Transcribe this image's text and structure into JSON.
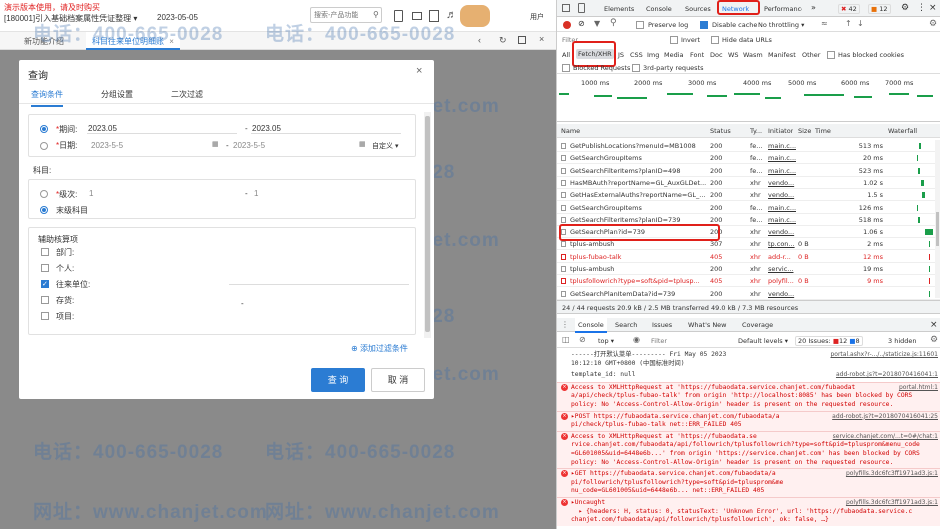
{
  "app": {
    "demo_notice": "演示版本使用，请及时购买",
    "account": "[180001]引入基础档案属性凭证整理",
    "date": "2023-05-05",
    "search_placeholder": "搜索-产品功能",
    "user": "用户",
    "tabs": [
      "新功能介绍",
      "科目往来单位明细账"
    ],
    "watermark_phone": "电话：400-665-0028",
    "watermark_url": "网址：www.chanjet.com"
  },
  "dialog": {
    "title": "查询",
    "tabs": [
      "查询条件",
      "分组设置",
      "二次过滤"
    ],
    "period_label": "期间:",
    "period_from": "2023.05",
    "period_to": "2023.05",
    "date_label": "日期:",
    "date_from": "2023-5-5",
    "date_to": "2023-5-5",
    "date_custom": "自定义",
    "subject_label": "科目:",
    "level_label": "级次:",
    "level_from": "1",
    "level_to": "1",
    "last_level": "末级科目",
    "aux_title": "辅助核算项",
    "aux_items": [
      {
        "label": "部门:",
        "checked": false
      },
      {
        "label": "个人:",
        "checked": false
      },
      {
        "label": "往来单位:",
        "checked": true
      },
      {
        "label": "存货:",
        "checked": false
      },
      {
        "label": "项目:",
        "checked": false
      }
    ],
    "add_filter": "添加过滤条件",
    "query_button": "查 询",
    "cancel_button": "取 消"
  },
  "devtools": {
    "tabs": [
      "Elements",
      "Console",
      "Sources",
      "Network",
      "Performance"
    ],
    "issues_errors": "42",
    "issues_warn": "12",
    "toolbar": {
      "preserve_log": "Preserve log",
      "disable_cache": "Disable cache",
      "throttling": "No throttling"
    },
    "filter_placeholder": "Filter",
    "invert": "Invert",
    "hide_data_urls": "Hide data URLs",
    "type_filters": [
      "All",
      "Fetch/XHR",
      "JS",
      "CSS",
      "Img",
      "Media",
      "Font",
      "Doc",
      "WS",
      "Wasm",
      "Manifest",
      "Other"
    ],
    "has_blocked_cookies": "Has blocked cookies",
    "blocked_requests": "Blocked Requests",
    "third_party": "3rd-party requests",
    "timeline_ticks": [
      "1000 ms",
      "2000 ms",
      "3000 ms",
      "4000 ms",
      "5000 ms",
      "6000 ms",
      "7000 ms"
    ],
    "columns": [
      "Name",
      "Status",
      "Ty...",
      "Initiator",
      "Size",
      "Time",
      "Waterfall"
    ],
    "requests": [
      {
        "name": "GetPublishLocations?menuId=MB1008",
        "status": "200",
        "type": "fe...",
        "initiator": "main.c...",
        "size": "",
        "time": "513 ms",
        "err": false
      },
      {
        "name": "GetSearchGroupItems",
        "status": "200",
        "type": "fe...",
        "initiator": "main.c...",
        "size": "",
        "time": "20 ms",
        "err": false
      },
      {
        "name": "GetSearchFilterItems?planID=498",
        "status": "200",
        "type": "fe...",
        "initiator": "main.c...",
        "size": "",
        "time": "523 ms",
        "err": false
      },
      {
        "name": "HasMBAuth?reportName=GL_AuxGLDet...",
        "status": "200",
        "type": "xhr",
        "initiator": "vendo...",
        "size": "",
        "time": "1.02 s",
        "err": false
      },
      {
        "name": "GetHasExternalAuths?reportName=GL_...",
        "status": "200",
        "type": "xhr",
        "initiator": "vendo...",
        "size": "",
        "time": "1.5 s",
        "err": false
      },
      {
        "name": "GetSearchGroupItems",
        "status": "200",
        "type": "fe...",
        "initiator": "main.c...",
        "size": "",
        "time": "126 ms",
        "err": false
      },
      {
        "name": "GetSearchFilterItems?planID=739",
        "status": "200",
        "type": "fe...",
        "initiator": "main.c...",
        "size": "",
        "time": "518 ms",
        "err": false
      },
      {
        "name": "GetSearchPlan?id=739",
        "status": "200",
        "type": "xhr",
        "initiator": "vendo...",
        "size": "",
        "time": "1.06 s",
        "err": false
      },
      {
        "name": "tplus-ambush",
        "status": "307",
        "type": "xhr",
        "initiator": "tp.con...",
        "size": "0 B",
        "time": "2 ms",
        "err": false
      },
      {
        "name": "tplus-fubao-talk",
        "status": "405",
        "type": "xhr",
        "initiator": "add-r...",
        "size": "0 B",
        "time": "12 ms",
        "err": true
      },
      {
        "name": "tplus-ambush",
        "status": "200",
        "type": "xhr",
        "initiator": "servic...",
        "size": "",
        "time": "19 ms",
        "err": false
      },
      {
        "name": "tplusfollowrich?type=soft&pid=tplusp...",
        "status": "405",
        "type": "xhr",
        "initiator": "polyfil...",
        "size": "0 B",
        "time": "9 ms",
        "err": true
      },
      {
        "name": "GetSearchPlanItemData?id=739",
        "status": "200",
        "type": "xhr",
        "initiator": "vendo...",
        "size": "",
        "time": "",
        "err": false
      }
    ],
    "summary": "24 / 44 requests    20.9 kB / 2.5 MB transferred    49.0 kB / 7.3 MB resources",
    "drawer_tabs": [
      "Console",
      "Search",
      "Issues",
      "What's New",
      "Coverage"
    ],
    "console_context": "top",
    "default_levels": "Default levels",
    "issues_count": "20 Issues:",
    "issues_red": "12",
    "issues_yellow": "8",
    "hidden": "3 hidden",
    "console_lines": [
      {
        "kind": "log",
        "text": "------打开默认菜单--------- Fri May 05 2023\n10:12:10 GMT+0800 (中国标准时间)",
        "src": "portal.ashx?r-.../../staticize.js:11601"
      },
      {
        "kind": "log",
        "text": "template_id: null",
        "src": "add-robot.js?t=2018070416041:1"
      },
      {
        "kind": "err",
        "text": "Access to XMLHttpRequest at 'https://fubaodata.service.chanjet.com/fubaodat\na/api/check/tplus-fubao-talk' from origin 'http://localhost:8085' has been blocked by CORS\npolicy: No 'Access-Control-Allow-Origin' header is present on the requested resource.",
        "src": "portal.html:1"
      },
      {
        "kind": "err",
        "text": "▸POST https://fubaodata.service.chanjet.com/fubaodata/a\npi/check/tplus-fubao-talk net::ERR_FAILED 405",
        "src": "add-robot.js?t=2018070416041:25"
      },
      {
        "kind": "err",
        "text": "Access to XMLHttpRequest at 'https://fubaodata.se\nrvice.chanjet.com/fubaodata/api/followrich/tplusfollowrich?type=soft&pid=tplusprom&menu_code\n=GL601005&uid=6448e6b...' from origin 'https://service.chanjet.com' has been blocked by CORS\npolicy: No 'Access-Control-Allow-Origin' header is present on the requested resource.",
        "src": "service.chanjet.com/...t=0#/chat:1"
      },
      {
        "kind": "err",
        "text": "▸GET https://fubaodata.service.chanjet.com/fubaodata/a\npi/followrich/tplusfollowrich?type=soft&pid=tplusprom&me\nnu_code=GL601005&uid=6448e6b... net::ERR_FAILED 405",
        "src": "polyfills.3dc6fc3ff1971ad3.js:1"
      },
      {
        "kind": "err",
        "text": "▸Uncaught\n  ▸ {headers: H, status: 0, statusText: 'Unknown Error', url: 'https://fubaodata.service.c\nchanjet.com/fubaodata/api/followrich/tplusfollowrich', ok: false, …}",
        "src": "polyfills.3dc6fc3ff1971ad3.js:1"
      }
    ]
  }
}
